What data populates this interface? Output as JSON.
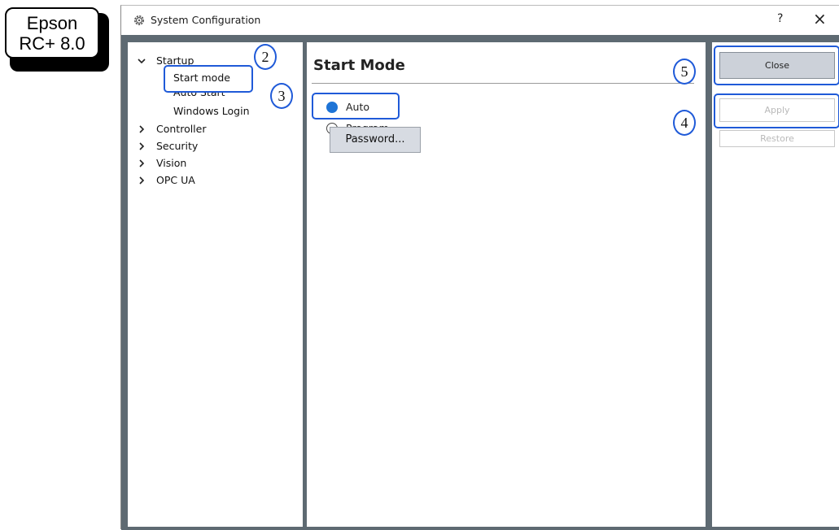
{
  "badge": {
    "line1": "Epson",
    "line2": "RC+ 8.0"
  },
  "window": {
    "title": "System Configuration",
    "help_label": "?",
    "close_label": "×",
    "icon": "gear-icon"
  },
  "tree": {
    "items": [
      {
        "label": "Startup",
        "expanded": true,
        "children": [
          "Start mode",
          "Auto Start",
          "Windows Login"
        ]
      },
      {
        "label": "Controller",
        "expanded": false
      },
      {
        "label": "Security",
        "expanded": false
      },
      {
        "label": "Vision",
        "expanded": false
      },
      {
        "label": "OPC UA",
        "expanded": false
      }
    ],
    "selected": "Start mode"
  },
  "main": {
    "title": "Start Mode",
    "options": [
      {
        "label": "Auto",
        "checked": true
      },
      {
        "label": "Program",
        "checked": false
      }
    ],
    "password_button": "Password..."
  },
  "side": {
    "close": "Close",
    "apply": "Apply",
    "restore": "Restore"
  },
  "callouts": [
    "2",
    "3",
    "4",
    "5"
  ],
  "colors": {
    "callout": "#1f5ad8",
    "radio_on": "#1e74d6",
    "frame": "#5e6a72"
  }
}
